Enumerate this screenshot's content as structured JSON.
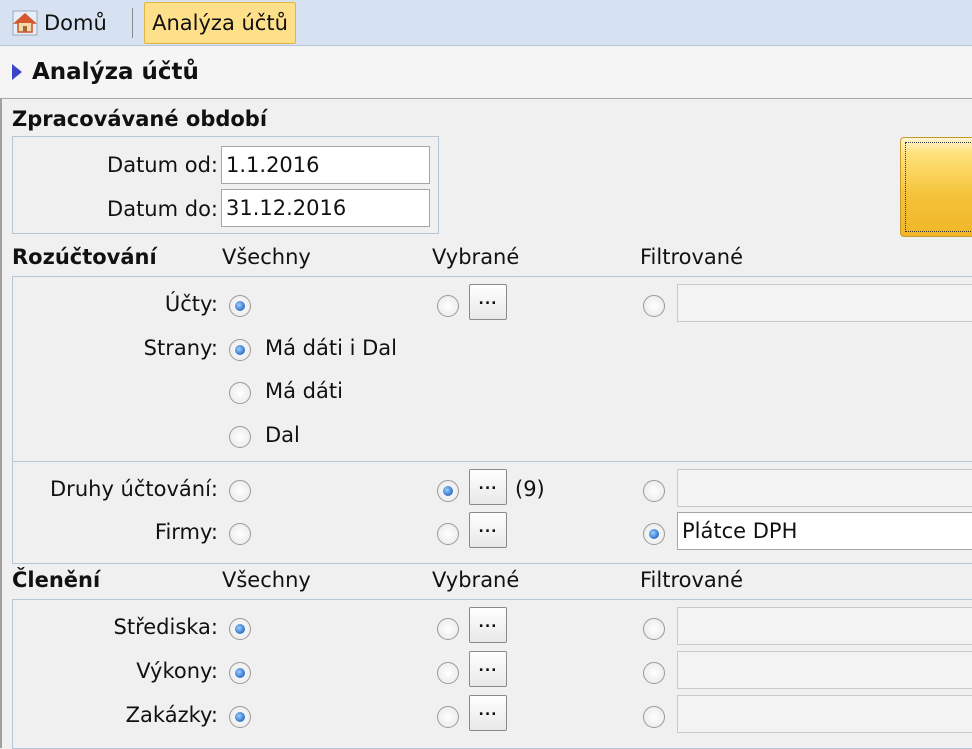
{
  "tabs": {
    "home_label": "Domů",
    "active_label": "Analýza účtů"
  },
  "header": {
    "title": "Analýza účtů"
  },
  "period": {
    "title": "Zpracovávané období",
    "from_label": "Datum od:",
    "from_value": "1.1.2016",
    "to_label": "Datum do:",
    "to_value": "31.12.2016"
  },
  "allocation": {
    "title": "Rozúčtování",
    "col_all": "Všechny",
    "col_selected": "Vybrané",
    "col_filtered": "Filtrované",
    "accounts_label": "Účty:",
    "sides_label": "Strany:",
    "side_options": [
      "Má dáti i Dal",
      "Má dáti",
      "Dal"
    ],
    "posting_types_label": "Druhy účtování:",
    "posting_types_count": "(9)",
    "companies_label": "Firmy:",
    "companies_filter_value": "Plátce DPH"
  },
  "breakdown": {
    "title": "Členění",
    "col_all": "Všechny",
    "col_selected": "Vybrané",
    "col_filtered": "Filtrované",
    "rows": [
      "Střediska:",
      "Výkony:",
      "Zakázky:"
    ]
  },
  "buttons": {
    "ellipsis": "..."
  },
  "colors": {
    "tab_active_bg": "#ffe08a",
    "radio_selected": "#2b6fc9",
    "action_button": "#f4c238"
  },
  "icons": {
    "home": "home-icon",
    "title_marker": "arrow-right-icon"
  }
}
